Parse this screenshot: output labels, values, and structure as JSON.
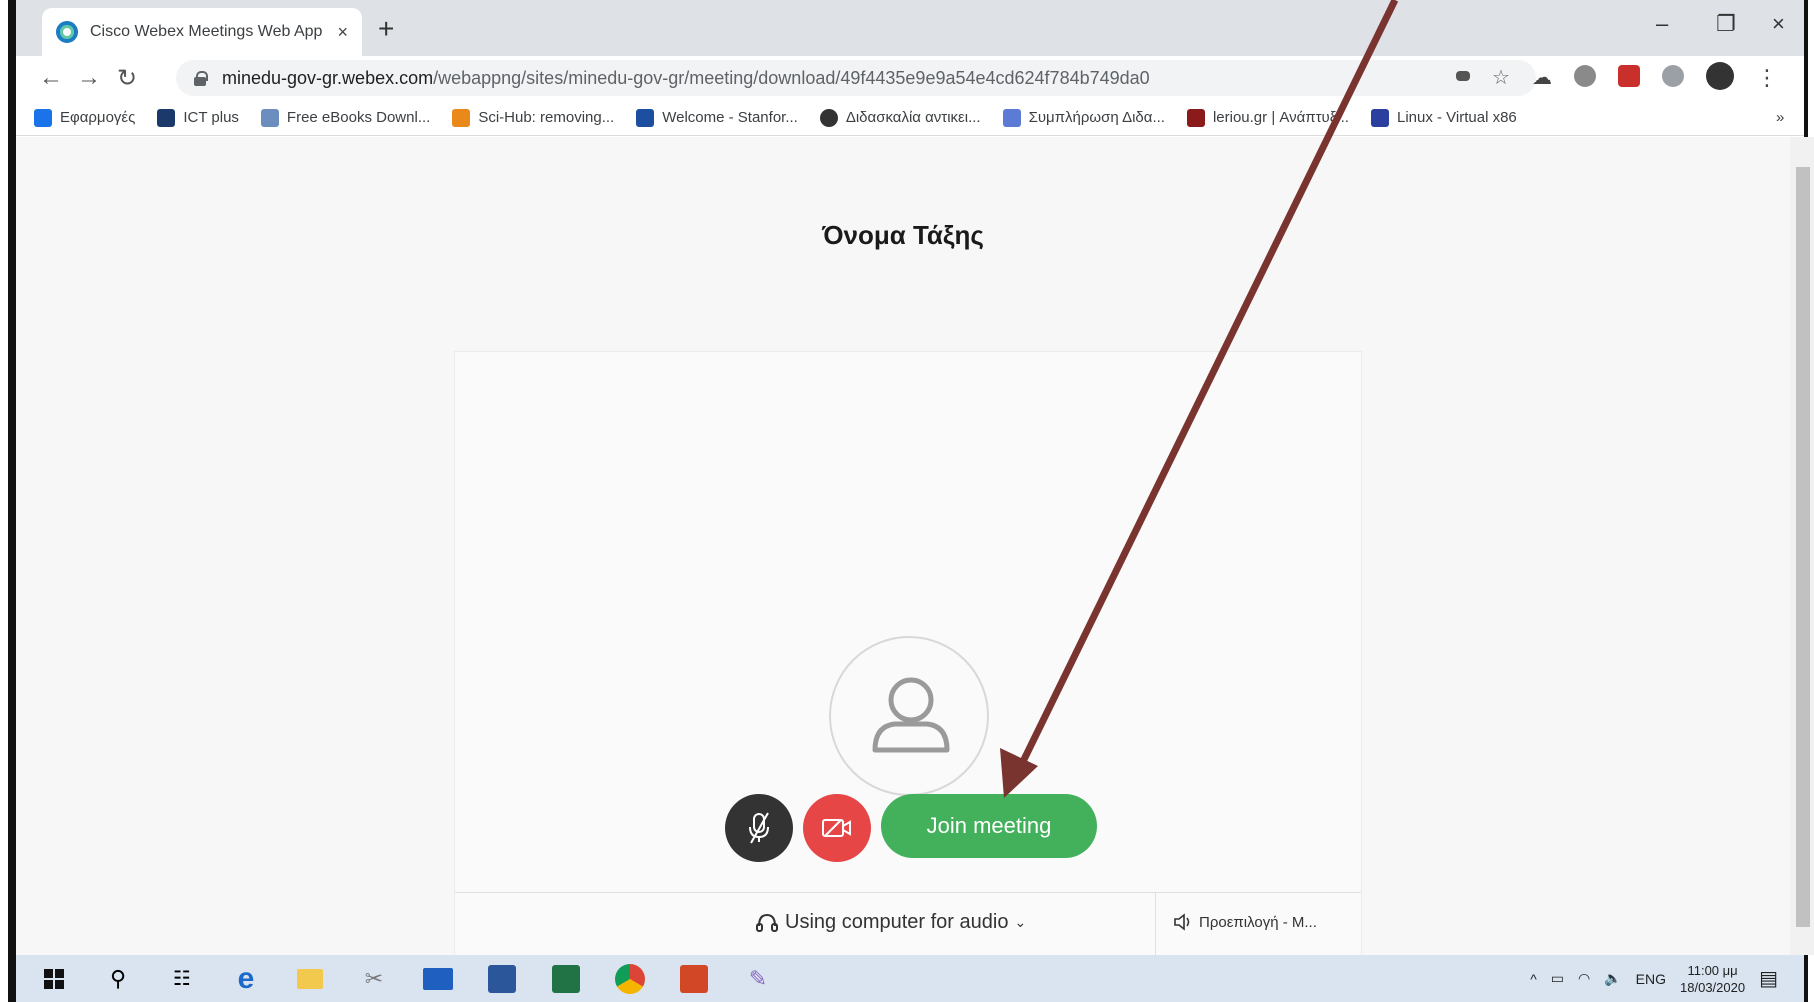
{
  "browser": {
    "tab_title": "Cisco Webex Meetings Web App",
    "tab_close": "×",
    "new_tab": "+",
    "win_minimize": "–",
    "win_restore": "❐",
    "win_close": "×",
    "url_host": "minedu-gov-gr.webex.com",
    "url_path": "/webappng/sites/minedu-gov-gr/meeting/download/49f4435e9e9a54e4cd624f784b749da0",
    "bookmarks": [
      {
        "label": "Εφαρμογές",
        "icon": "apps-grid-icon"
      },
      {
        "label": "ICT plus",
        "icon": "ict-logo-icon"
      },
      {
        "label": "Free eBooks Downl...",
        "icon": "feather-icon"
      },
      {
        "label": "Sci-Hub: removing...",
        "icon": "scihub-icon"
      },
      {
        "label": "Welcome - Stanfor...",
        "icon": "infinity-icon"
      },
      {
        "label": "Διδασκαλία αντικει...",
        "icon": "globe-icon"
      },
      {
        "label": "Συμπλήρωση Διδα...",
        "icon": "form-icon"
      },
      {
        "label": "leriou.gr | Ανάπτυξ...",
        "icon": "monitor-icon"
      },
      {
        "label": "Linux - Virtual x86",
        "icon": "linux-icon"
      }
    ],
    "bookmarks_overflow": "»"
  },
  "page": {
    "meeting_title": "Όνομα Τάξης",
    "join_button": "Join meeting",
    "audio_option": "Using computer for audio",
    "speaker_option": "Προεπιλογή - Μ..."
  },
  "taskbar": {
    "language": "ENG",
    "time": "11:00 μμ",
    "date": "18/03/2020"
  },
  "colors": {
    "join_green": "#43b05c",
    "video_red": "#e74646",
    "mute_dark": "#333333",
    "arrow": "#7a3430"
  }
}
